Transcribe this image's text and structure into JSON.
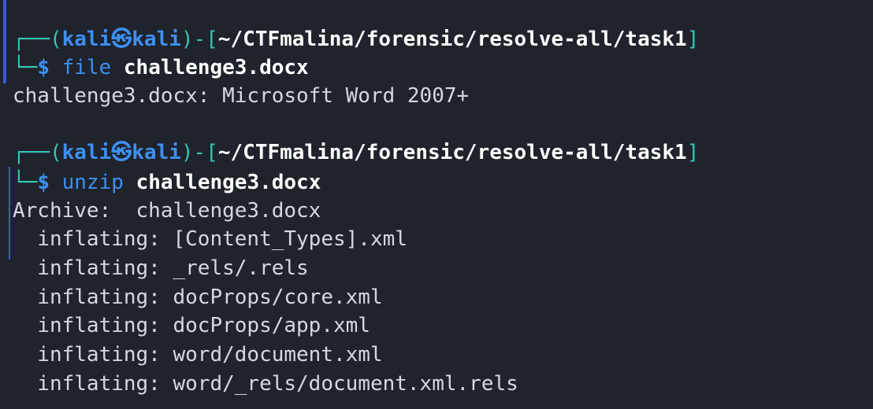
{
  "prompt": {
    "box_top_left": "┌──",
    "open_paren": "(",
    "user": "kali",
    "at_symbol": "㉿",
    "host": "kali",
    "close_paren": ")",
    "dash": "-",
    "open_bracket": "[",
    "path": "~/CTFmalina/forensic/resolve-all/task1",
    "close_bracket": "]",
    "box_bottom_left": "└─",
    "dollar": "$"
  },
  "blocks": [
    {
      "command": "file",
      "argument": "challenge3.docx",
      "output": [
        "challenge3.docx: Microsoft Word 2007+"
      ]
    },
    {
      "command": "unzip",
      "argument": "challenge3.docx",
      "output": [
        "Archive:  challenge3.docx",
        "  inflating: [Content_Types].xml",
        "  inflating: _rels/.rels",
        "  inflating: docProps/core.xml",
        "  inflating: docProps/app.xml",
        "  inflating: word/document.xml",
        "  inflating: word/_rels/document.xml.rels"
      ]
    }
  ]
}
